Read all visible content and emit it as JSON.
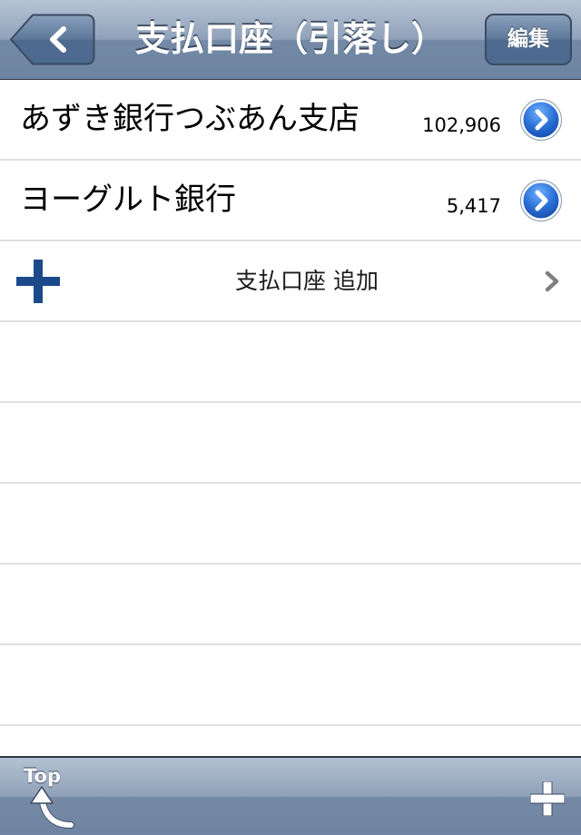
{
  "nav": {
    "title": "支払口座（引落し）",
    "back_icon": "chevron-left-icon",
    "edit_label": "編集"
  },
  "accounts": [
    {
      "name": "あずき銀行つぶあん支店",
      "amount": "102,906",
      "detail_icon": "blue-disclosure-icon"
    },
    {
      "name": "ヨーグルト銀行",
      "amount": "5,417",
      "detail_icon": "blue-disclosure-icon"
    }
  ],
  "add_row": {
    "icon": "plus-icon",
    "label": "支払口座 追加",
    "chevron_icon": "chevron-right-icon"
  },
  "toolbar": {
    "top_label": "Top",
    "top_icon": "curved-up-arrow-icon",
    "add_icon": "plus-icon"
  },
  "colors": {
    "nav_bar": "#8fa1b9",
    "add_plus": "#1b4a8a",
    "disclosure_blue": "#2a6fd6"
  }
}
